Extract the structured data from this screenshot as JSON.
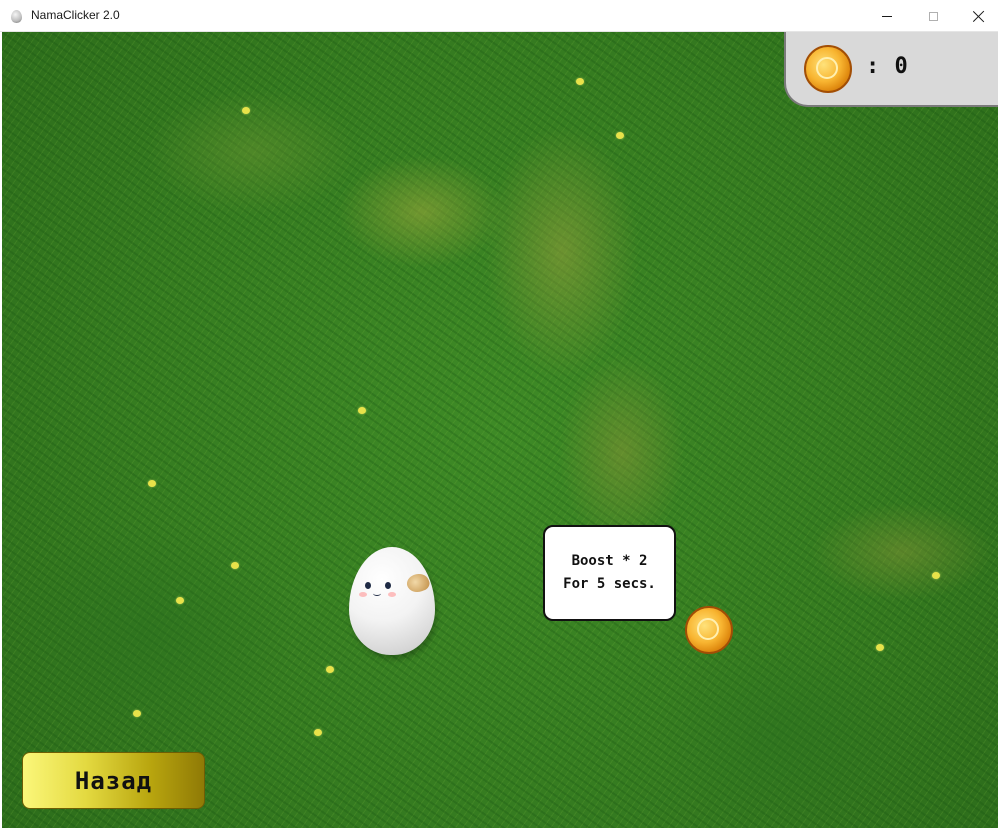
{
  "window": {
    "title": "NamaClicker 2.0",
    "icon": "egg-app-icon",
    "controls": [
      "minimize-icon",
      "maximize-icon",
      "close-icon"
    ]
  },
  "hud": {
    "coin_icon": "gold-coin-icon",
    "coin_count": ": 0"
  },
  "boost": {
    "line1": "Boost * 2",
    "line2": "For 5 secs.",
    "coin_icon": "gold-coin-icon"
  },
  "character": {
    "icon": "egg-character"
  },
  "back_button": {
    "label": "Назад"
  },
  "colors": {
    "grass": "#357b20",
    "panel": "#d9d9d9",
    "coin": "#f8b531",
    "button_light": "#fbf77a",
    "button_dark": "#8f7a06"
  }
}
